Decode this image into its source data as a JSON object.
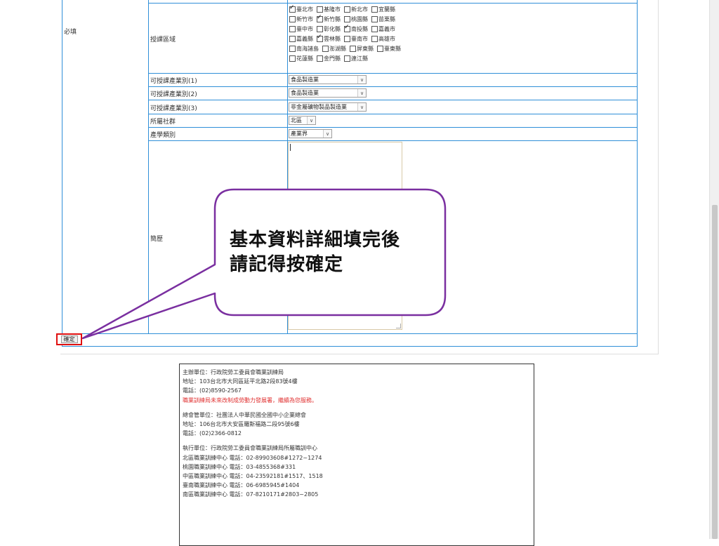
{
  "form": {
    "required_label": "必填",
    "rows": {
      "region": {
        "label": "授課區域",
        "cities": [
          [
            {
              "name": "臺北市",
              "checked": true
            },
            {
              "name": "基隆市",
              "checked": false
            },
            {
              "name": "新北市",
              "checked": false
            },
            {
              "name": "宜蘭縣",
              "checked": false
            }
          ],
          [
            {
              "name": "新竹市",
              "checked": false
            },
            {
              "name": "新竹縣",
              "checked": true
            },
            {
              "name": "桃園縣",
              "checked": false
            },
            {
              "name": "苗栗縣",
              "checked": false
            }
          ],
          [
            {
              "name": "臺中市",
              "checked": false
            },
            {
              "name": "彰化縣",
              "checked": false
            },
            {
              "name": "南投縣",
              "checked": true
            },
            {
              "name": "嘉義市",
              "checked": false
            }
          ],
          [
            {
              "name": "嘉義縣",
              "checked": false
            },
            {
              "name": "雲林縣",
              "checked": true
            },
            {
              "name": "臺南市",
              "checked": false
            },
            {
              "name": "高雄市",
              "checked": false
            }
          ],
          [
            {
              "name": "南海諸島",
              "checked": false
            },
            {
              "name": "澎湖縣",
              "checked": false
            },
            {
              "name": "屏東縣",
              "checked": false
            },
            {
              "name": "臺東縣",
              "checked": false
            }
          ],
          [
            {
              "name": "花蓮縣",
              "checked": false
            },
            {
              "name": "金門縣",
              "checked": false
            },
            {
              "name": "連江縣",
              "checked": false
            }
          ]
        ]
      },
      "industry1": {
        "label": "可授課產業別(1)",
        "value": "食品製造業"
      },
      "industry2": {
        "label": "可授課產業別(2)",
        "value": "食品製造業"
      },
      "industry3": {
        "label": "可授課產業別(3)",
        "value": "非金屬礦物製品製造業"
      },
      "community": {
        "label": "所屬社群",
        "value": "北區"
      },
      "category": {
        "label": "產學類別",
        "value": "產業界"
      },
      "resume": {
        "label": "簡歷",
        "value": ""
      }
    },
    "confirm_label": "確定"
  },
  "callout": {
    "line1": "基本資料詳細填完後",
    "line2": "請記得按確定"
  },
  "footer": {
    "organizer": "主辦單位：行政院勞工委員會職業訓練局",
    "organizer_address": "地址：103台北市大同區延平北路2段83號4樓",
    "organizer_phone": "電話：(02)8590-2567",
    "slogan": "職業訓練局未來改制成勞動力發展署，繼續為您服務。",
    "executor": "總會管單位：社團法人中華民國全國中小企業總會",
    "executor_address": "地址：106台北市大安區羅斯福路二段95號6樓",
    "executor_phone": "電話：(02)2366-0812",
    "center": "執行單位：行政院勞工委員會職業訓練局所屬職訓中心",
    "centers": [
      "北區職業訓練中心 電話：02-89903608#1272~1274",
      "桃園職業訓練中心 電話：03-4855368#331",
      "中區職業訓練中心 電話：04-23592181#1517、1518",
      "臺南職業訓練中心 電話：06-6985945#1404",
      "南區職業訓練中心 電話：07-8210171#2803~2805"
    ]
  },
  "colors": {
    "table_border": "#2f8fd8",
    "highlight_red": "#e01010",
    "callout_purple": "#7a2fa0"
  }
}
